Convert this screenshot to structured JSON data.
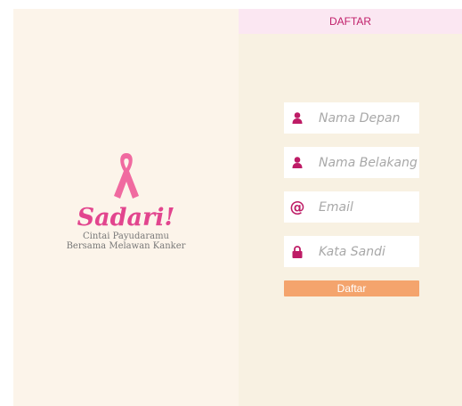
{
  "header": {
    "title": "DAFTAR"
  },
  "brand": {
    "name": "Sadari!",
    "tagline_line1": "Cintai Payudaramu",
    "tagline_line2": "Bersama Melawan Kanker"
  },
  "form": {
    "first_name_placeholder": "Nama Depan",
    "last_name_placeholder": "Nama Belakang",
    "email_placeholder": "Email",
    "email_icon_glyph": "@",
    "password_placeholder": "Kata Sandi",
    "submit_label": "Daftar"
  },
  "icons": {
    "ribbon": "pink-ribbon-icon",
    "first_name": "user-icon",
    "last_name": "user-icon",
    "email": "at-icon",
    "password": "lock-icon"
  },
  "colors": {
    "accent": "#c01f6a",
    "ribbon": "#f06aa0",
    "brand": "#e2458e",
    "button": "#f4a46d",
    "header_bg": "#fbe7f2",
    "panel_bg": "#f8f1e2"
  }
}
